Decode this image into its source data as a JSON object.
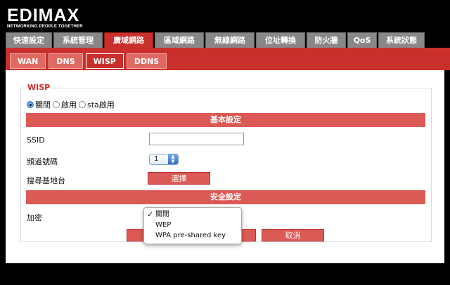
{
  "brand": {
    "name": "EDIMAX",
    "tagline": "NETWORKING PEOPLE TOGETHER"
  },
  "main_tabs": [
    {
      "label": "快速設定",
      "active": false
    },
    {
      "label": "系統管理",
      "active": false
    },
    {
      "label": "廣域網路",
      "active": true
    },
    {
      "label": "區域網路",
      "active": false
    },
    {
      "label": "無線網路",
      "active": false
    },
    {
      "label": "位址轉換",
      "active": false
    },
    {
      "label": "防火牆",
      "active": false
    },
    {
      "label": "QoS",
      "active": false
    },
    {
      "label": "系統狀態",
      "active": false
    }
  ],
  "sub_tabs": [
    {
      "label": "WAN",
      "active": false
    },
    {
      "label": "DNS",
      "active": false
    },
    {
      "label": "WISP",
      "active": true
    },
    {
      "label": "DDNS",
      "active": false
    }
  ],
  "wisp": {
    "title": "WISP",
    "mode_options": [
      {
        "label": "關閉",
        "checked": true
      },
      {
        "label": "啟用",
        "checked": false
      },
      {
        "label": "sta啟用",
        "checked": false
      }
    ],
    "basic_header": "基本設定",
    "ssid_label": "SSID",
    "ssid_value": "",
    "channel_label": "頻道號碼",
    "channel_value": "1",
    "site_survey_label": "搜尋基地台",
    "select_button": "選擇",
    "security_header": "安全設定",
    "encryption_label": "加密",
    "encryption_options": [
      {
        "label": "關閉",
        "selected": true
      },
      {
        "label": "WEP",
        "selected": false
      },
      {
        "label": "WPA pre-shared key",
        "selected": false
      }
    ],
    "cancel_button": "取消"
  },
  "colors": {
    "accent_red": "#c9302c",
    "tab_gray": "#888888",
    "bar_red": "#dc5a55"
  }
}
